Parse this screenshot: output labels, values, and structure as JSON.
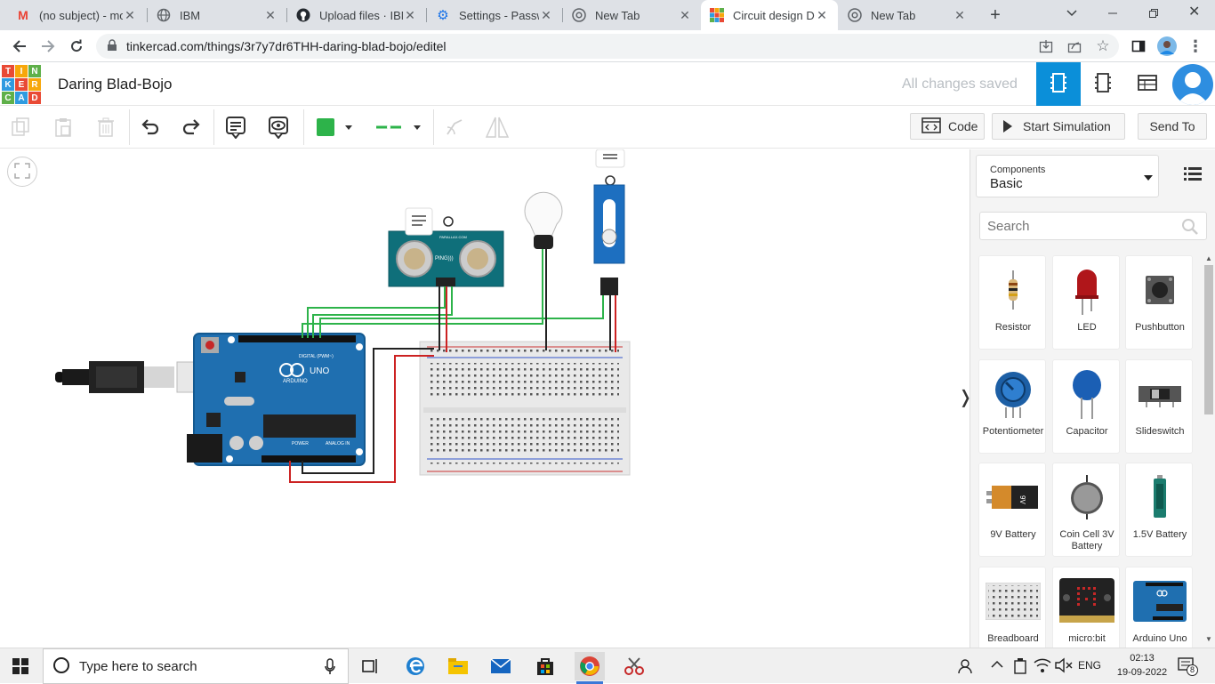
{
  "browser": {
    "tabs": [
      {
        "title": "(no subject) - mo",
        "icon": "gmail-icon"
      },
      {
        "title": "IBM",
        "icon": "globe-icon"
      },
      {
        "title": "Upload files · IBM",
        "icon": "github-icon"
      },
      {
        "title": "Settings - Passwo",
        "icon": "settings-gear-icon"
      },
      {
        "title": "New Tab",
        "icon": "chrome-icon"
      },
      {
        "title": "Circuit design Da",
        "icon": "tinkercad-icon",
        "active": true
      },
      {
        "title": "New Tab",
        "icon": "chrome-icon"
      }
    ],
    "url": "tinkercad.com/things/3r7y7dr6THH-daring-blad-bojo/editel"
  },
  "header": {
    "logo_letters": [
      "T",
      "I",
      "N",
      "K",
      "E",
      "R",
      "C",
      "A",
      "D"
    ],
    "design_title": "Daring Blad-Bojo",
    "save_status": "All changes saved"
  },
  "toolbar": {
    "fill_color": "#2db34a",
    "wire_color": "#2db34a",
    "code_label": "Code",
    "simulate_label": "Start Simulation",
    "send_to_label": "Send To"
  },
  "panel": {
    "components_label": "Components",
    "components_value": "Basic",
    "search_placeholder": "Search",
    "items": [
      {
        "label": "Resistor"
      },
      {
        "label": "LED"
      },
      {
        "label": "Pushbutton"
      },
      {
        "label": "Potentiometer"
      },
      {
        "label": "Capacitor"
      },
      {
        "label": "Slideswitch"
      },
      {
        "label": "9V Battery"
      },
      {
        "label": "Coin Cell 3V Battery"
      },
      {
        "label": "1.5V Battery"
      },
      {
        "label": "Breadboard"
      },
      {
        "label": "micro:bit"
      },
      {
        "label": "Arduino Uno"
      }
    ]
  },
  "circuit": {
    "arduino_brand": "ARDUINO",
    "arduino_model": "UNO",
    "arduino_digital": "DIGITAL (PWM~)",
    "arduino_power": "POWER",
    "arduino_analog": "ANALOG IN",
    "sensor_label": "PING)))",
    "sensor_brand": "PARALLAX.COM",
    "battery_text": "9V"
  },
  "taskbar": {
    "search_placeholder": "Type here to search",
    "language": "ENG",
    "time": "02:13",
    "date": "19-09-2022",
    "notification_count": "8"
  }
}
